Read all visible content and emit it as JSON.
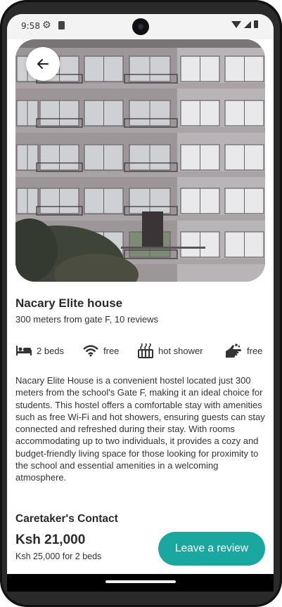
{
  "status_bar": {
    "time": "9:58",
    "icons": [
      "gear-icon",
      "sd-card-icon",
      "wifi-icon",
      "cell-signal-icon",
      "battery-icon"
    ]
  },
  "hero": {
    "image_subject": "apartment building facade",
    "carousel_pages": 5,
    "carousel_active_index": 0,
    "back_icon": "arrow-left-icon"
  },
  "listing": {
    "title": "Nacary Elite house",
    "subtitle": "300 meters from gate F, 10 reviews",
    "amenities": [
      {
        "icon": "bed-icon",
        "label": "2 beds"
      },
      {
        "icon": "wifi-icon",
        "label": "free"
      },
      {
        "icon": "shower-icon",
        "label": "hot shower"
      },
      {
        "icon": "hand-wash-icon",
        "label": "free"
      }
    ],
    "description": "Nacary Elite House is a convenient hostel located just 300 meters from the school's Gate F, making it an ideal choice for students. This hostel offers a comfortable stay with amenities such as free Wi-Fi and hot showers, ensuring guests can stay connected and refreshed during their stay. With rooms accommodating up to two individuals, it provides a cozy and budget-friendly living space for those looking for proximity to the school and essential amenities in a welcoming atmosphere."
  },
  "contact": {
    "heading": "Caretaker's Contact",
    "price": "Ksh 21,000",
    "price_note": "Ksh 25,000 for 2 beds",
    "review_button": "Leave a review"
  },
  "colors": {
    "accent": "#1aa7a0",
    "text": "#2b2b2b",
    "background": "#ffffff"
  }
}
